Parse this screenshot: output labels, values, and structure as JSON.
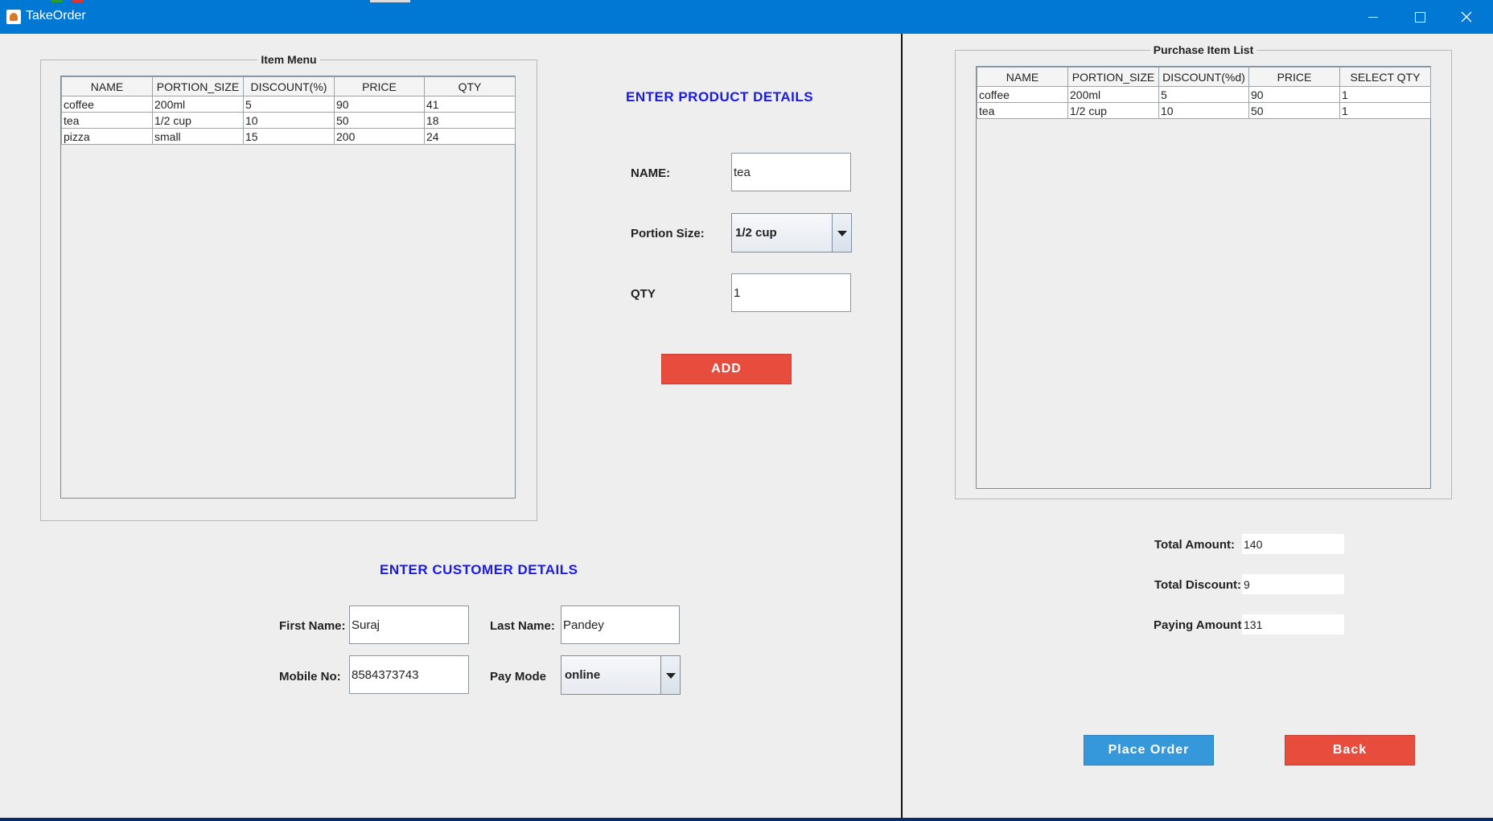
{
  "window": {
    "title": "TakeOrder"
  },
  "item_menu": {
    "title": "Item Menu",
    "columns": [
      "NAME",
      "PORTION_SIZE",
      "DISCOUNT(%)",
      "PRICE",
      "QTY"
    ],
    "rows": [
      [
        "coffee",
        "200ml",
        "5",
        "90",
        "41"
      ],
      [
        "tea",
        "1/2 cup",
        "10",
        "50",
        "18"
      ],
      [
        "pizza",
        "small",
        "15",
        "200",
        "24"
      ]
    ]
  },
  "product": {
    "heading": "ENTER PRODUCT DETAILS",
    "name_label": "NAME:",
    "name_value": "tea",
    "portion_label": "Portion Size:",
    "portion_value": "1/2 cup",
    "qty_label": "QTY",
    "qty_value": "1",
    "add_label": "ADD"
  },
  "customer": {
    "heading": "ENTER CUSTOMER DETAILS",
    "first_name_label": "First Name:",
    "first_name_value": "Suraj",
    "last_name_label": "Last Name:",
    "last_name_value": "Pandey",
    "mobile_label": "Mobile No:",
    "mobile_value": "8584373743",
    "paymode_label": "Pay Mode",
    "paymode_value": "online"
  },
  "purchase_list": {
    "title": "Purchase Item List",
    "columns": [
      "NAME",
      "PORTION_SIZE",
      "DISCOUNT(%d)",
      "PRICE",
      "SELECT QTY"
    ],
    "rows": [
      [
        "coffee",
        "200ml",
        "5",
        "90",
        "1"
      ],
      [
        "tea",
        "1/2 cup",
        "10",
        "50",
        "1"
      ]
    ]
  },
  "totals": {
    "total_amount_label": "Total Amount:",
    "total_amount_value": "140",
    "total_discount_label": "Total Discount:",
    "total_discount_value": "9",
    "paying_amount_label": "Paying Amount:",
    "paying_amount_value": "131"
  },
  "actions": {
    "place_order_label": "Place Order",
    "back_label": "Back"
  },
  "colors": {
    "titlebar": "#0078d4",
    "heading_blue": "#1a1ae6",
    "button_red": "#e74c3c",
    "button_blue": "#3498db"
  }
}
